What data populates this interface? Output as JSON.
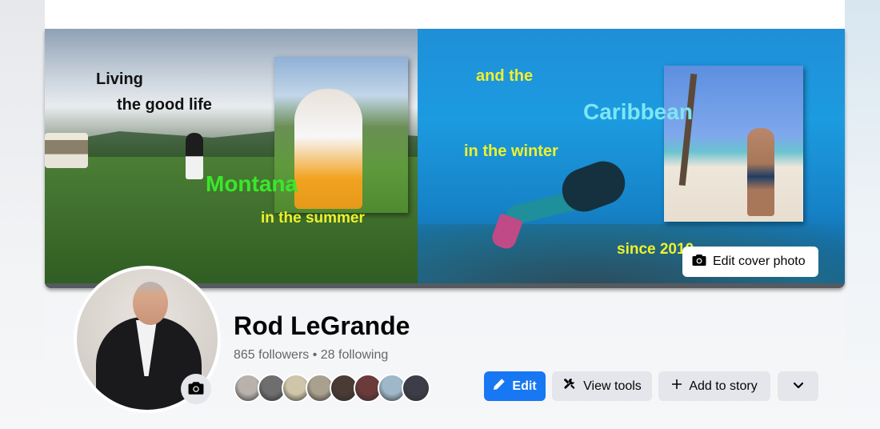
{
  "cover": {
    "text_living": "Living",
    "text_good_life": "the good life",
    "text_montana": "Montana",
    "text_summer": "in the summer",
    "text_and_the": "and the",
    "text_caribbean": "Caribbean",
    "text_winter": "in the winter",
    "text_since": "since 2010",
    "edit_cover_label": "Edit cover photo"
  },
  "profile": {
    "name": "Rod LeGrande",
    "stats": "865 followers • 28 following",
    "friend_avatar_colors": [
      "#b9b1ab",
      "#6e6e6e",
      "#cfc5a8",
      "#a9a08e",
      "#4a3b34",
      "#6b3a3a",
      "#9fb8c9",
      "#3d3d4a"
    ]
  },
  "actions": {
    "edit_label": "Edit",
    "view_tools_label": "View tools",
    "add_story_label": "Add to story"
  },
  "icons": {
    "edit": "pencil-icon",
    "view_tools": "tools-icon",
    "add_story": "plus-icon",
    "more": "chevron-down-icon",
    "cover_camera": "camera-icon",
    "avatar_camera": "camera-icon"
  },
  "colors": {
    "primary": "#1877f2",
    "secondary_button": "#e4e6eb",
    "text_primary": "#050505",
    "text_secondary": "#65676b"
  }
}
